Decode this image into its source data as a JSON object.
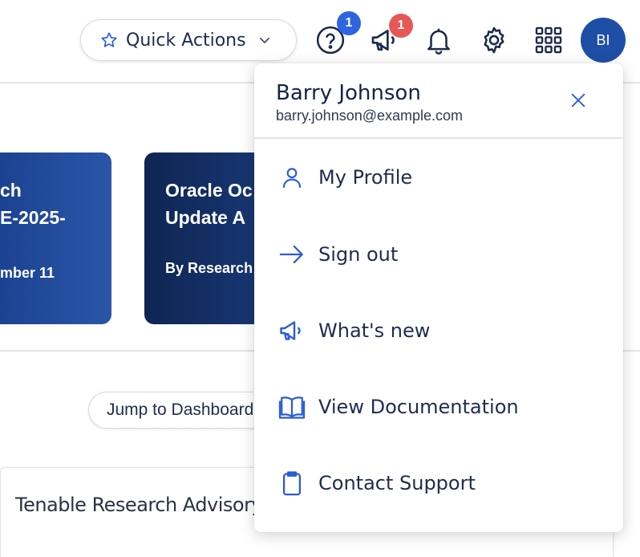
{
  "header": {
    "quick_actions_label": "Quick Actions",
    "help_badge_count": "1",
    "announcements_badge_count": "1",
    "avatar_initials": "BI"
  },
  "cards": [
    {
      "title_line1": "ch",
      "title_line2": "E-2025-",
      "meta": "mber 11"
    },
    {
      "title_line1": "Oracle Oc",
      "title_line2": "Update A",
      "meta": "By Research"
    }
  ],
  "jump_button_label": "Jump to Dashboard",
  "panel": {
    "title": "Tenable Research Advisory"
  },
  "user_menu": {
    "name": "Barry Johnson",
    "email": "barry.johnson@example.com",
    "items": [
      {
        "label": "My Profile",
        "icon": "user-icon"
      },
      {
        "label": "Sign out",
        "icon": "arrow-right-icon"
      },
      {
        "label": "What's new",
        "icon": "megaphone-icon"
      },
      {
        "label": "View Documentation",
        "icon": "book-icon"
      },
      {
        "label": "Contact Support",
        "icon": "clipboard-icon"
      }
    ]
  },
  "colors": {
    "accent": "#2a5bd7",
    "avatar": "#1e4fa6",
    "badge_blue": "#2f64e0",
    "badge_red": "#e65757"
  }
}
